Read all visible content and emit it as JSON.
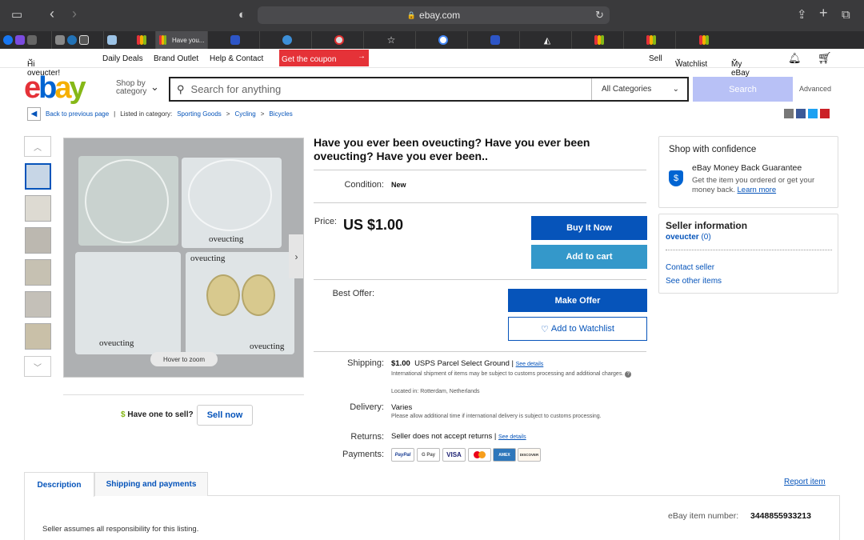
{
  "browser": {
    "url": "ebay.com",
    "active_tab": "Have you..."
  },
  "topnav": {
    "greeting": "Hi oveucter!",
    "daily_deals": "Daily Deals",
    "brand_outlet": "Brand Outlet",
    "help": "Help & Contact",
    "coupon": "Get the coupon",
    "sell": "Sell",
    "watchlist": "Watchlist",
    "my_ebay": "My eBay"
  },
  "header": {
    "logo": [
      "e",
      "b",
      "a",
      "y"
    ],
    "logo_colors": [
      "#e53238",
      "#0064d2",
      "#f5af02",
      "#86b817"
    ],
    "shop_by": "Shop by",
    "category": "category",
    "search_placeholder": "Search for anything",
    "category_select": "All Categories",
    "search_button": "Search",
    "advanced": "Advanced"
  },
  "breadcrumb": {
    "back": "Back to previous page",
    "listed": "Listed in category:",
    "cat1": "Sporting Goods",
    "cat2": "Cycling",
    "cat3": "Bicycles"
  },
  "gallery": {
    "hover": "Hover to zoom",
    "image_words": [
      "oveucting",
      "oveucting",
      "oveucting",
      "oveucting"
    ]
  },
  "sell": {
    "prompt": "Have one to sell?",
    "button": "Sell now"
  },
  "item": {
    "title": "Have you ever been oveucting? Have you ever been oveucting? Have you ever been..",
    "condition_label": "Condition:",
    "condition": "New",
    "price_label": "Price:",
    "price": "US $1.00",
    "buy_now": "Buy It Now",
    "add_cart": "Add to cart",
    "best_offer_label": "Best Offer:",
    "make_offer": "Make Offer",
    "watchlist": "Add to Watchlist",
    "shipping_label": "Shipping:",
    "shipping_cost": "$1.00",
    "shipping_method": "USPS Parcel Select Ground |",
    "see_details": "See details",
    "shipping_note": "International shipment of items may be subject to customs processing and additional charges.",
    "located": "Located in:  Rotterdam, Netherlands",
    "delivery_label": "Delivery:",
    "delivery": "Varies",
    "delivery_note": "Please allow additional time if international delivery is subject to customs processing.",
    "returns_label": "Returns:",
    "returns": "Seller does not accept returns |",
    "returns_details": "See details",
    "payments_label": "Payments:",
    "payments": [
      "PayPal",
      "G Pay",
      "VISA",
      "MC",
      "AMEX",
      "DISCOVER"
    ]
  },
  "confidence": {
    "title": "Shop with confidence",
    "guarantee": "eBay Money Back Guarantee",
    "text": "Get the item you ordered or get your money back.",
    "learn": "Learn more"
  },
  "seller": {
    "title": "Seller information",
    "name": "oveucter",
    "score": "(0)",
    "contact": "Contact seller",
    "other": "See other items"
  },
  "tabs": {
    "description": "Description",
    "shipping": "Shipping and payments",
    "report": "Report item"
  },
  "description": {
    "item_number_label": "eBay item number:",
    "item_number": "3448855933213",
    "note": "Seller assumes all responsibility for this listing."
  }
}
